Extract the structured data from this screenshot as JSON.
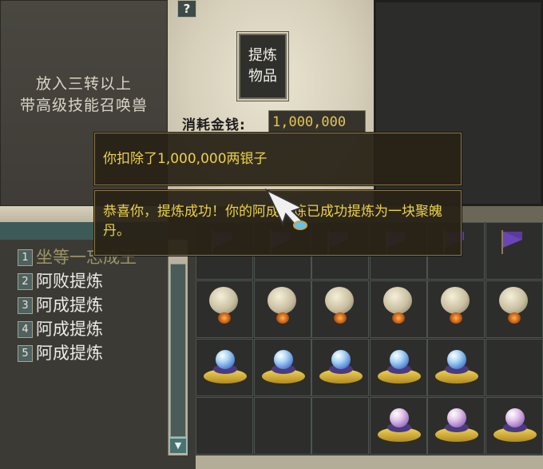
{
  "slot_panel": {
    "hint_lines": [
      "放入三转以上",
      "带高级技能召唤兽"
    ]
  },
  "help_button": {
    "label": "?"
  },
  "refine_button": {
    "label_lines": [
      "提炼",
      "物品"
    ]
  },
  "cost": {
    "label": "消耗金钱:",
    "value": "1,000,000"
  },
  "messages": [
    {
      "text": "你扣除了1,000,000两银子"
    },
    {
      "text": "恭喜你，提炼成功！你的阿成提炼已成功提炼为一块聚魄丹。"
    }
  ],
  "summon_list": {
    "items": [
      {
        "num": "1",
        "label": "坐等一忘成王"
      },
      {
        "num": "2",
        "label": "阿败提炼"
      },
      {
        "num": "3",
        "label": "阿成提炼"
      },
      {
        "num": "4",
        "label": "阿成提炼"
      },
      {
        "num": "5",
        "label": "阿成提炼"
      }
    ],
    "scroll_down_icon": "triangle-down"
  },
  "inventory": {
    "rows": [
      [
        "purple-flag",
        "purple-flag",
        "purple-flag",
        "purple-flag",
        "purple-flag",
        "purple-flag"
      ],
      [
        "lantern",
        "lantern",
        "lantern",
        "lantern",
        "lantern",
        "lantern"
      ],
      [
        "blue-orb",
        "blue-orb",
        "blue-orb",
        "blue-orb",
        "blue-orb",
        "empty"
      ],
      [
        "empty",
        "empty",
        "empty",
        "pink-orb",
        "pink-orb",
        "pink-orb"
      ]
    ]
  },
  "colors": {
    "message_text": "#ecd247",
    "cost_value": "#e8c84a",
    "parchment": "#e3ddc9"
  }
}
